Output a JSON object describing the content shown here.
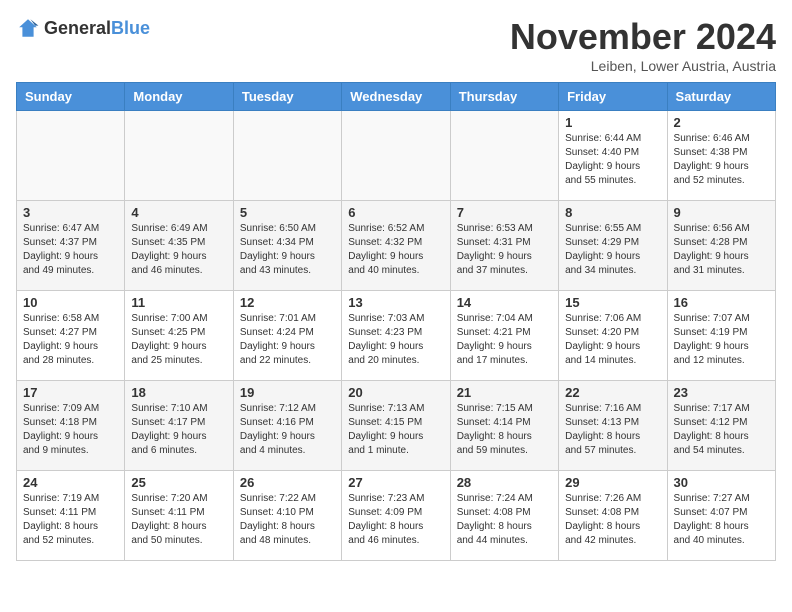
{
  "header": {
    "logo_general": "General",
    "logo_blue": "Blue",
    "title": "November 2024",
    "location": "Leiben, Lower Austria, Austria"
  },
  "calendar": {
    "days_of_week": [
      "Sunday",
      "Monday",
      "Tuesday",
      "Wednesday",
      "Thursday",
      "Friday",
      "Saturday"
    ],
    "weeks": [
      [
        {
          "day": "",
          "detail": ""
        },
        {
          "day": "",
          "detail": ""
        },
        {
          "day": "",
          "detail": ""
        },
        {
          "day": "",
          "detail": ""
        },
        {
          "day": "",
          "detail": ""
        },
        {
          "day": "1",
          "detail": "Sunrise: 6:44 AM\nSunset: 4:40 PM\nDaylight: 9 hours\nand 55 minutes."
        },
        {
          "day": "2",
          "detail": "Sunrise: 6:46 AM\nSunset: 4:38 PM\nDaylight: 9 hours\nand 52 minutes."
        }
      ],
      [
        {
          "day": "3",
          "detail": "Sunrise: 6:47 AM\nSunset: 4:37 PM\nDaylight: 9 hours\nand 49 minutes."
        },
        {
          "day": "4",
          "detail": "Sunrise: 6:49 AM\nSunset: 4:35 PM\nDaylight: 9 hours\nand 46 minutes."
        },
        {
          "day": "5",
          "detail": "Sunrise: 6:50 AM\nSunset: 4:34 PM\nDaylight: 9 hours\nand 43 minutes."
        },
        {
          "day": "6",
          "detail": "Sunrise: 6:52 AM\nSunset: 4:32 PM\nDaylight: 9 hours\nand 40 minutes."
        },
        {
          "day": "7",
          "detail": "Sunrise: 6:53 AM\nSunset: 4:31 PM\nDaylight: 9 hours\nand 37 minutes."
        },
        {
          "day": "8",
          "detail": "Sunrise: 6:55 AM\nSunset: 4:29 PM\nDaylight: 9 hours\nand 34 minutes."
        },
        {
          "day": "9",
          "detail": "Sunrise: 6:56 AM\nSunset: 4:28 PM\nDaylight: 9 hours\nand 31 minutes."
        }
      ],
      [
        {
          "day": "10",
          "detail": "Sunrise: 6:58 AM\nSunset: 4:27 PM\nDaylight: 9 hours\nand 28 minutes."
        },
        {
          "day": "11",
          "detail": "Sunrise: 7:00 AM\nSunset: 4:25 PM\nDaylight: 9 hours\nand 25 minutes."
        },
        {
          "day": "12",
          "detail": "Sunrise: 7:01 AM\nSunset: 4:24 PM\nDaylight: 9 hours\nand 22 minutes."
        },
        {
          "day": "13",
          "detail": "Sunrise: 7:03 AM\nSunset: 4:23 PM\nDaylight: 9 hours\nand 20 minutes."
        },
        {
          "day": "14",
          "detail": "Sunrise: 7:04 AM\nSunset: 4:21 PM\nDaylight: 9 hours\nand 17 minutes."
        },
        {
          "day": "15",
          "detail": "Sunrise: 7:06 AM\nSunset: 4:20 PM\nDaylight: 9 hours\nand 14 minutes."
        },
        {
          "day": "16",
          "detail": "Sunrise: 7:07 AM\nSunset: 4:19 PM\nDaylight: 9 hours\nand 12 minutes."
        }
      ],
      [
        {
          "day": "17",
          "detail": "Sunrise: 7:09 AM\nSunset: 4:18 PM\nDaylight: 9 hours\nand 9 minutes."
        },
        {
          "day": "18",
          "detail": "Sunrise: 7:10 AM\nSunset: 4:17 PM\nDaylight: 9 hours\nand 6 minutes."
        },
        {
          "day": "19",
          "detail": "Sunrise: 7:12 AM\nSunset: 4:16 PM\nDaylight: 9 hours\nand 4 minutes."
        },
        {
          "day": "20",
          "detail": "Sunrise: 7:13 AM\nSunset: 4:15 PM\nDaylight: 9 hours\nand 1 minute."
        },
        {
          "day": "21",
          "detail": "Sunrise: 7:15 AM\nSunset: 4:14 PM\nDaylight: 8 hours\nand 59 minutes."
        },
        {
          "day": "22",
          "detail": "Sunrise: 7:16 AM\nSunset: 4:13 PM\nDaylight: 8 hours\nand 57 minutes."
        },
        {
          "day": "23",
          "detail": "Sunrise: 7:17 AM\nSunset: 4:12 PM\nDaylight: 8 hours\nand 54 minutes."
        }
      ],
      [
        {
          "day": "24",
          "detail": "Sunrise: 7:19 AM\nSunset: 4:11 PM\nDaylight: 8 hours\nand 52 minutes."
        },
        {
          "day": "25",
          "detail": "Sunrise: 7:20 AM\nSunset: 4:11 PM\nDaylight: 8 hours\nand 50 minutes."
        },
        {
          "day": "26",
          "detail": "Sunrise: 7:22 AM\nSunset: 4:10 PM\nDaylight: 8 hours\nand 48 minutes."
        },
        {
          "day": "27",
          "detail": "Sunrise: 7:23 AM\nSunset: 4:09 PM\nDaylight: 8 hours\nand 46 minutes."
        },
        {
          "day": "28",
          "detail": "Sunrise: 7:24 AM\nSunset: 4:08 PM\nDaylight: 8 hours\nand 44 minutes."
        },
        {
          "day": "29",
          "detail": "Sunrise: 7:26 AM\nSunset: 4:08 PM\nDaylight: 8 hours\nand 42 minutes."
        },
        {
          "day": "30",
          "detail": "Sunrise: 7:27 AM\nSunset: 4:07 PM\nDaylight: 8 hours\nand 40 minutes."
        }
      ]
    ]
  }
}
